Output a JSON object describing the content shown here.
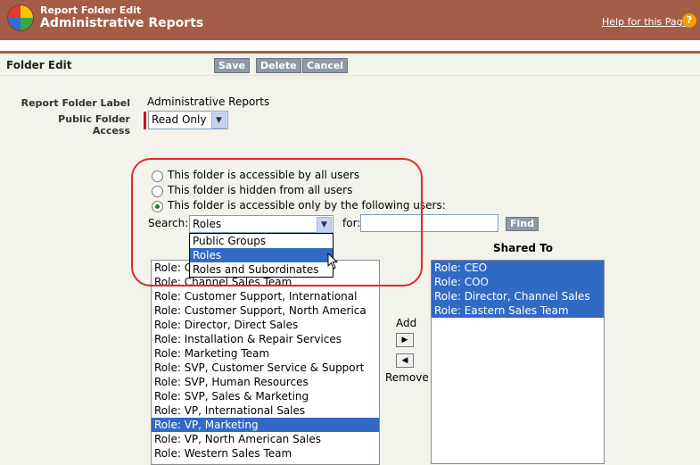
{
  "header": {
    "subtitle": "Report Folder Edit",
    "title": "Administrative Reports",
    "help_link": "Help for this Page",
    "help_icon": "?"
  },
  "section": {
    "title": "Folder Edit",
    "buttons": {
      "save": "Save",
      "delete": "Delete",
      "cancel": "Cancel"
    }
  },
  "form": {
    "label_caption": "Report Folder Label",
    "label_value": "Administrative Reports",
    "access_caption": "Public Folder Access",
    "access_value": "Read Only"
  },
  "access_options": [
    {
      "label": "This folder is accessible by all users",
      "checked": false
    },
    {
      "label": "This folder is hidden from all users",
      "checked": false
    },
    {
      "label": "This folder is accessible only by the following users:",
      "checked": true
    }
  ],
  "search": {
    "label": "Search:",
    "selected": "Roles",
    "for_label": "for:",
    "find_label": "Find",
    "options": [
      "Public Groups",
      "Roles",
      "Roles and Subordinates"
    ],
    "highlighted": 1
  },
  "available": {
    "items": [
      "Role: CEO",
      "Role: Channel Sales Team",
      "Role: Customer Support, International",
      "Role: Customer Support, North America",
      "Role: Director, Direct Sales",
      "Role: Installation & Repair Services",
      "Role: Marketing Team",
      "Role: SVP, Customer Service & Support",
      "Role: SVP, Human Resources",
      "Role: SVP, Sales & Marketing",
      "Role: VP, International Sales",
      "Role: VP, Marketing",
      "Role: VP, North American Sales",
      "Role: Western Sales Team"
    ],
    "selected_index": 11
  },
  "controls": {
    "add": "Add",
    "remove": "Remove"
  },
  "shared": {
    "title": "Shared To",
    "items": [
      "Role: CEO",
      "Role: COO",
      "Role: Director, Channel Sales",
      "Role: Eastern Sales Team"
    ]
  }
}
